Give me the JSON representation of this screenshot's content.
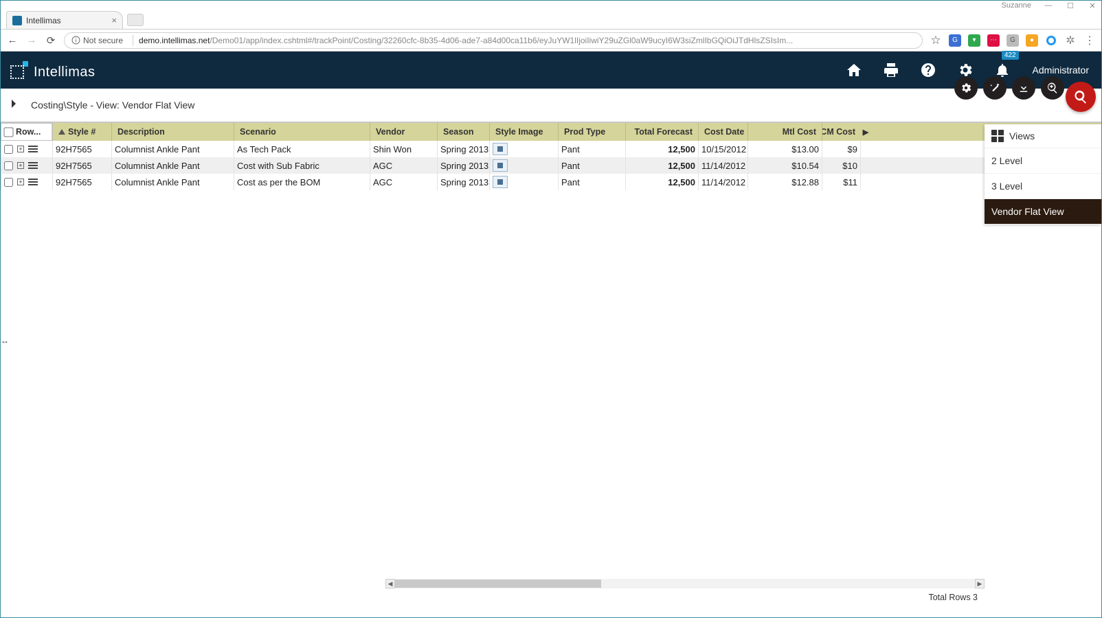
{
  "window": {
    "user": "Suzanne"
  },
  "browser": {
    "tab_title": "Intellimas",
    "security_label": "Not secure",
    "host": "demo.intellimas.net",
    "path": "/Demo01/app/index.cshtml#/trackPoint/Costing/32260cfc-8b35-4d06-ade7-a84d00ca11b6/eyJuYW1lIjoiIiwiY29uZGl0aW9ucyI6W3siZmlIbGQiOiJTdHlsZSIsIm..."
  },
  "app": {
    "name": "Intellimas",
    "notification_count": "422",
    "user_label": "Administrator"
  },
  "breadcrumb": "Costing\\Style - View: Vendor Flat View",
  "grid": {
    "row_header": "Row...",
    "columns": [
      "Style #",
      "Description",
      "Scenario",
      "Vendor",
      "Season",
      "Style Image",
      "Prod Type",
      "Total Forecast",
      "Cost Date",
      "Mtl Cost",
      "CM Cost"
    ],
    "rows": [
      {
        "style": "92H7565",
        "desc": "Columnist Ankle Pant",
        "scen": "As Tech Pack",
        "vend": "Shin Won",
        "seas": "Spring 2013",
        "ptype": "Pant",
        "tfore": "12,500",
        "cdate": "10/15/2012",
        "mtl": "$13.00",
        "cm": "$9"
      },
      {
        "style": "92H7565",
        "desc": "Columnist Ankle Pant",
        "scen": "Cost with Sub Fabric",
        "vend": "AGC",
        "seas": "Spring 2013",
        "ptype": "Pant",
        "tfore": "12,500",
        "cdate": "11/14/2012",
        "mtl": "$10.54",
        "cm": "$10"
      },
      {
        "style": "92H7565",
        "desc": "Columnist Ankle Pant",
        "scen": "Cost as per the BOM",
        "vend": "AGC",
        "seas": "Spring 2013",
        "ptype": "Pant",
        "tfore": "12,500",
        "cdate": "11/14/2012",
        "mtl": "$12.88",
        "cm": "$11"
      }
    ],
    "total_rows_label": "Total Rows 3"
  },
  "views": {
    "title": "Views",
    "items": [
      "2 Level",
      "3 Level",
      "Vendor Flat View"
    ],
    "active_index": 2
  }
}
